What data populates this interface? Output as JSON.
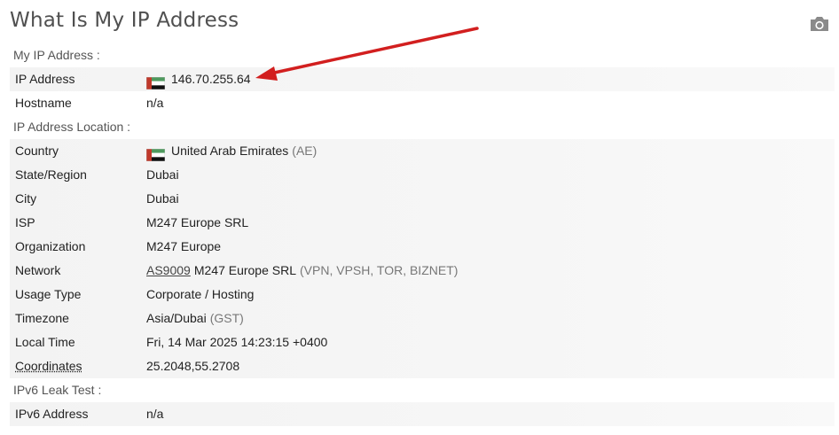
{
  "title": "What Is My IP Address",
  "icons": {
    "camera": "camera-icon",
    "flag": "uae-flag-icon"
  },
  "colors": {
    "arrow": "#d21f1f",
    "row_shade": "#f3f3f3"
  },
  "sections": {
    "my_ip": "My IP Address :",
    "location": "IP Address Location :",
    "ipv6": "IPv6 Leak Test :"
  },
  "ip": {
    "label": "IP Address",
    "value": "146.70.255.64"
  },
  "hostname": {
    "label": "Hostname",
    "value": "n/a"
  },
  "country": {
    "label": "Country",
    "value": "United Arab Emirates",
    "code": "(AE)"
  },
  "state": {
    "label": "State/Region",
    "value": "Dubai"
  },
  "city": {
    "label": "City",
    "value": "Dubai"
  },
  "isp": {
    "label": "ISP",
    "value": "M247 Europe SRL"
  },
  "organization": {
    "label": "Organization",
    "value": "M247 Europe"
  },
  "network": {
    "label": "Network",
    "asn": "AS9009",
    "name": "M247 Europe SRL",
    "tags": "(VPN, VPSH, TOR, BIZNET)"
  },
  "usage": {
    "label": "Usage Type",
    "value": "Corporate / Hosting"
  },
  "timezone": {
    "label": "Timezone",
    "value": "Asia/Dubai",
    "abbr": "(GST)"
  },
  "local_time": {
    "label": "Local Time",
    "value": "Fri, 14 Mar 2025 14:23:15 +0400"
  },
  "coordinates": {
    "label": "Coordinates",
    "value": "25.2048,55.2708"
  },
  "ipv6": {
    "label": "IPv6 Address",
    "value": "n/a"
  }
}
